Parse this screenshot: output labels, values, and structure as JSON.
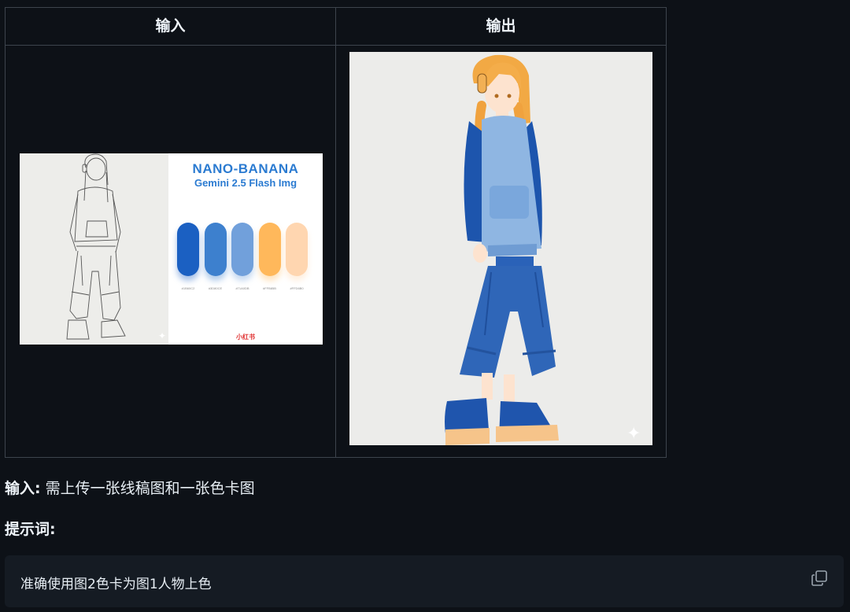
{
  "table": {
    "header_input": "输入",
    "header_output": "输出"
  },
  "input_card": {
    "title": "NANO-BANANA",
    "subtitle": "Gemini 2.5 Flash Img",
    "swatches": [
      {
        "color": "#1B60C2",
        "hex": "#1B60C2"
      },
      {
        "color": "#3D80CE",
        "hex": "#3D80CE"
      },
      {
        "color": "#71A0DB",
        "hex": "#71A0DB"
      },
      {
        "color": "#FFB85B",
        "hex": "#FFB85B"
      },
      {
        "color": "#FFD6B0",
        "hex": "#FFD6B0"
      }
    ],
    "watermark": "小红书"
  },
  "body": {
    "input_label": "输入:",
    "input_text": " 需上传一张线稿图和一张色卡图",
    "prompt_label": "提示词:",
    "prompt_text": "准确使用图2色卡为图1人物上色"
  }
}
